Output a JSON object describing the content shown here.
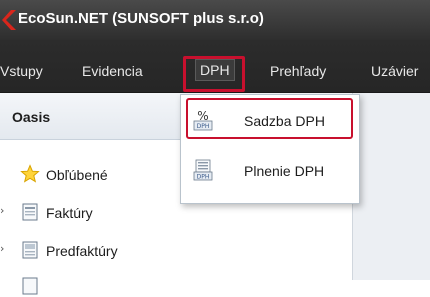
{
  "window": {
    "title": "EcoSun.NET  (SUNSOFT plus s.r.o)"
  },
  "menubar": {
    "items": [
      {
        "label": "Vstupy"
      },
      {
        "label": "Evidencia"
      },
      {
        "label": "DPH"
      },
      {
        "label": "Prehľady"
      },
      {
        "label": "Uzávier"
      }
    ]
  },
  "panel": {
    "title": "Oasis",
    "items": [
      {
        "label": "Obľúbené",
        "icon": "star-icon"
      },
      {
        "label": "Faktúry",
        "icon": "invoice-icon"
      },
      {
        "label": "Predfaktúry",
        "icon": "proforma-icon"
      }
    ]
  },
  "dropdown": {
    "items": [
      {
        "label": "Sadzba DPH",
        "icon": "percent-dph-icon"
      },
      {
        "label": "Plnenie DPH",
        "icon": "dph-report-icon"
      }
    ]
  },
  "colors": {
    "highlight": "#c8102e",
    "titlebar": "#3a3a3a",
    "logo": "#d9261c"
  }
}
